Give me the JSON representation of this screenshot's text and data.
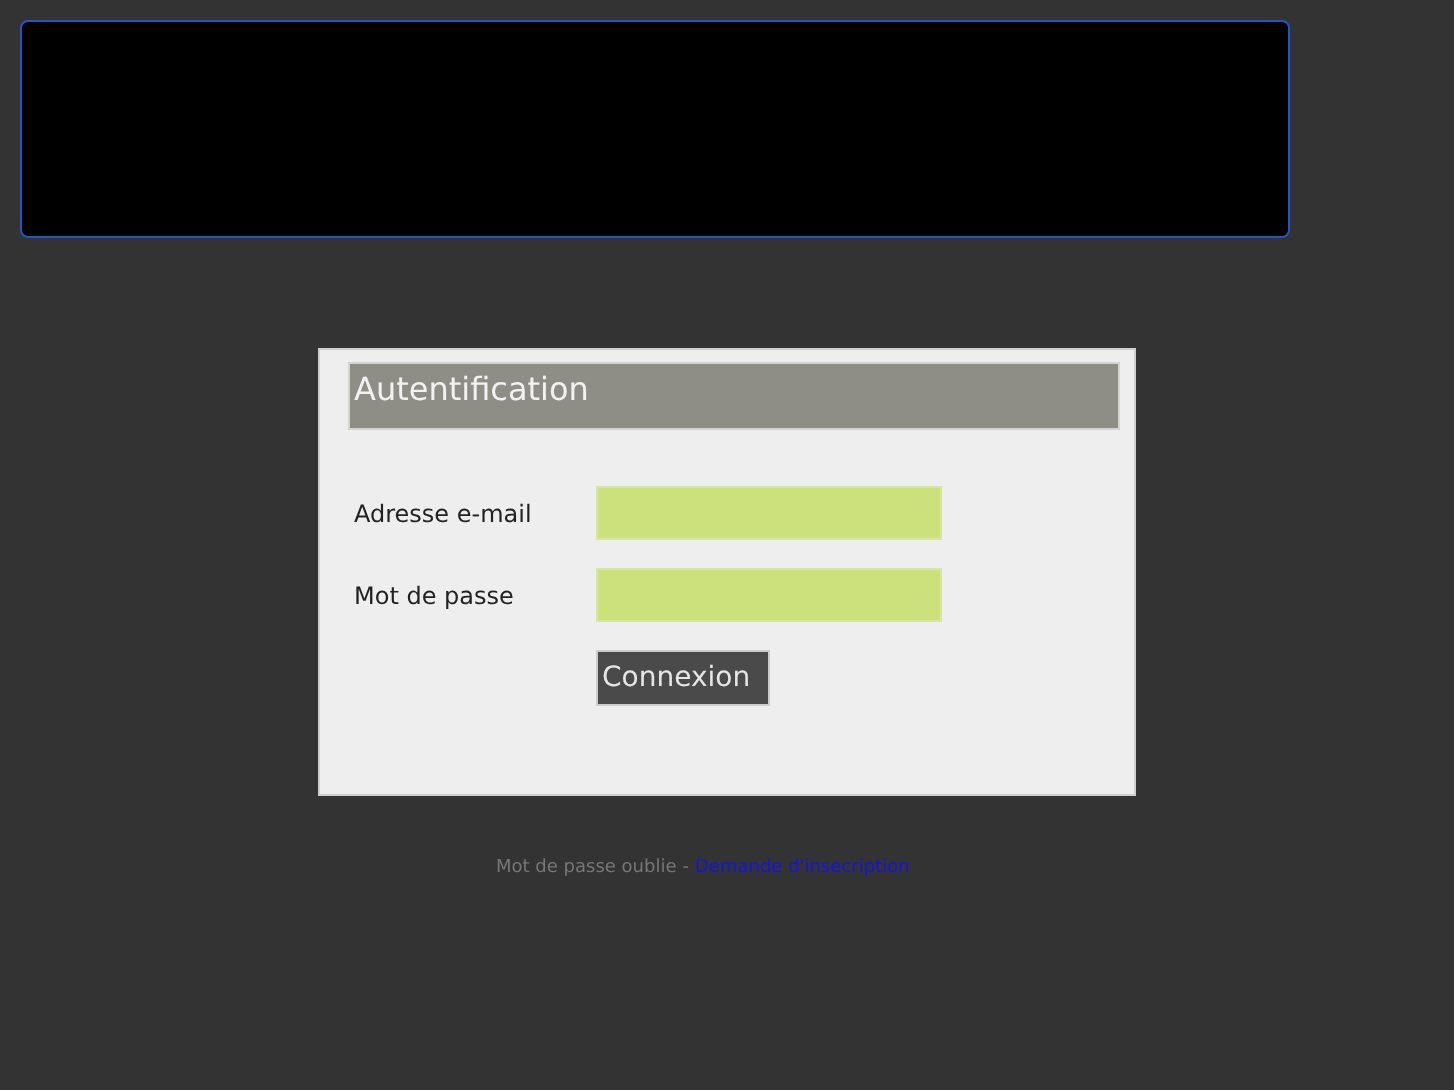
{
  "login": {
    "title": "Autentification",
    "fields": [
      {
        "label": "Adresse e-mail"
      },
      {
        "label": "Mot de passe"
      }
    ],
    "submit": "Connexion"
  },
  "footer": {
    "forgot_link": "Mot de passe oublie",
    "separator": "-",
    "signup_link": "Demande d'insecription"
  }
}
